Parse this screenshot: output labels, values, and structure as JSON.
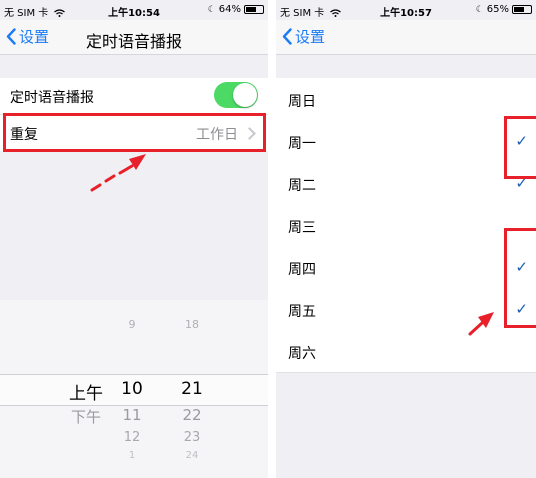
{
  "left": {
    "status": {
      "carrier": "无 SIM 卡",
      "time": "上午10:54",
      "battery": "64%",
      "battery_level": 0.64
    },
    "nav": {
      "back_label": "设置",
      "title": "定时语音播报"
    },
    "toggle_row": {
      "label": "定时语音播报",
      "on": true
    },
    "repeat_row": {
      "label": "重复",
      "value": "工作日"
    },
    "picker": {
      "above": {
        "hour": "9",
        "minute": "18"
      },
      "selected": {
        "period": "上午",
        "hour": "10",
        "minute": "21"
      },
      "below1": {
        "period": "下午",
        "hour": "11",
        "minute": "22"
      },
      "below2": {
        "hour": "12",
        "minute": "23"
      },
      "below3": {
        "hour": "1",
        "minute": "24"
      }
    }
  },
  "right": {
    "status": {
      "carrier": "无 SIM 卡",
      "time": "上午10:57",
      "battery": "65%",
      "battery_level": 0.65
    },
    "nav": {
      "back_label": "设置"
    },
    "days": [
      {
        "label": "周日",
        "checked": false
      },
      {
        "label": "周一",
        "checked": true
      },
      {
        "label": "周二",
        "checked": true
      },
      {
        "label": "周三",
        "checked": false
      },
      {
        "label": "周四",
        "checked": true
      },
      {
        "label": "周五",
        "checked": true
      },
      {
        "label": "周六",
        "checked": false
      }
    ],
    "check_glyph": "✓"
  },
  "colors": {
    "accent": "#1b7cf5",
    "toggle_on": "#4cd964",
    "annotation": "#e8202a",
    "checkmark": "#1b5fb5"
  }
}
